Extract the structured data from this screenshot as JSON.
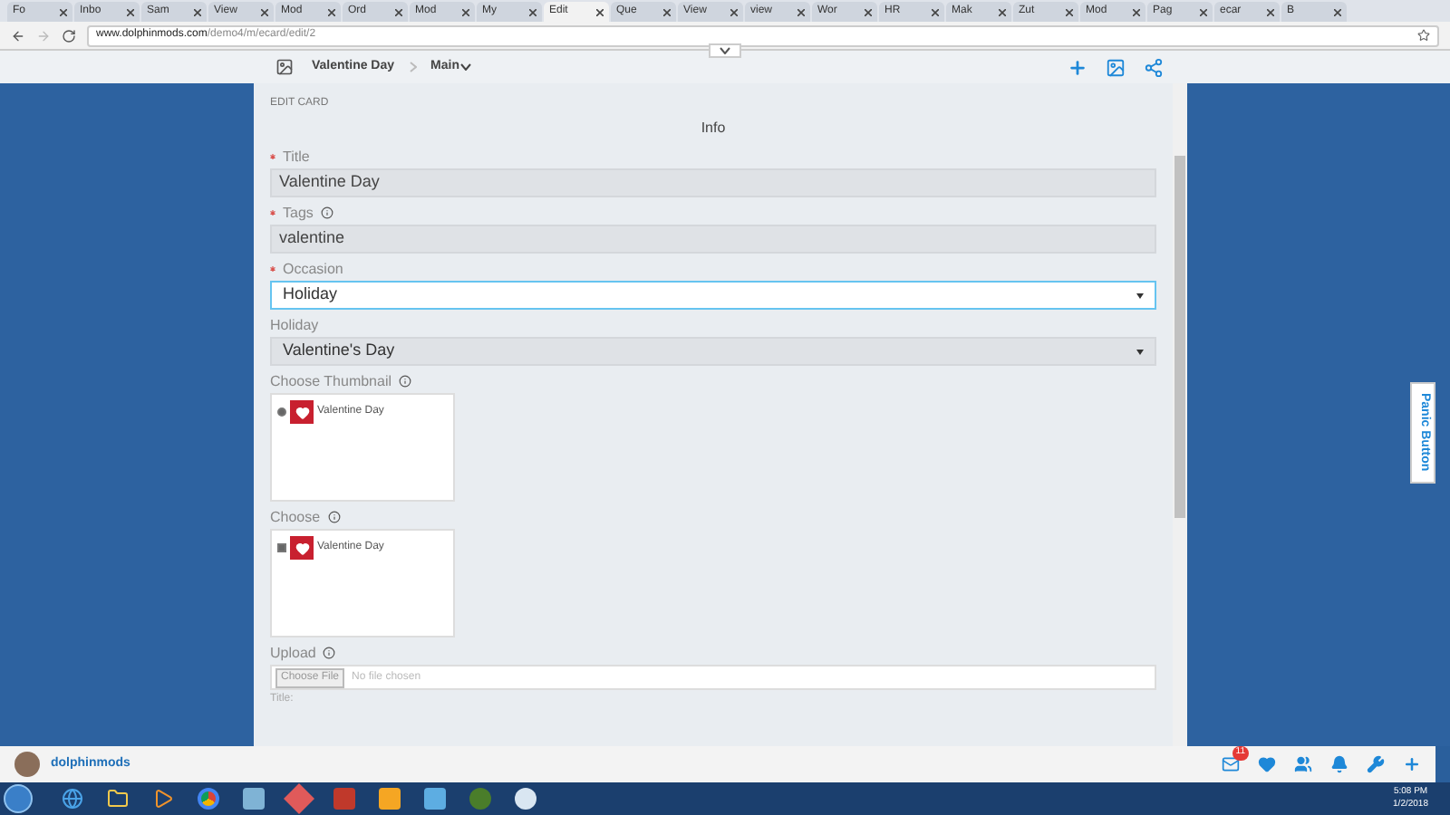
{
  "browser": {
    "tabs": [
      {
        "label": "Fo",
        "selected": false
      },
      {
        "label": "Inbo",
        "selected": false
      },
      {
        "label": "Sam",
        "selected": false
      },
      {
        "label": "View",
        "selected": false
      },
      {
        "label": "Mod",
        "selected": false
      },
      {
        "label": "Ord",
        "selected": false
      },
      {
        "label": "Mod",
        "selected": false
      },
      {
        "label": "My",
        "selected": false
      },
      {
        "label": "Edit",
        "selected": true
      },
      {
        "label": "Que",
        "selected": false
      },
      {
        "label": "View",
        "selected": false
      },
      {
        "label": "view",
        "selected": false
      },
      {
        "label": "Wor",
        "selected": false
      },
      {
        "label": "HR",
        "selected": false
      },
      {
        "label": "Mak",
        "selected": false
      },
      {
        "label": "Zut",
        "selected": false
      },
      {
        "label": "Mod",
        "selected": false
      },
      {
        "label": "Pag",
        "selected": false
      },
      {
        "label": "ecar",
        "selected": false
      },
      {
        "label": "B",
        "selected": false
      }
    ],
    "url_host": "www.dolphinmods.com",
    "url_path": "/demo4/m/ecard/edit/2"
  },
  "header": {
    "title": "Valentine Day",
    "section": "Main"
  },
  "card": {
    "heading": "EDIT CARD",
    "section_title": "Info",
    "fields": [
      {
        "kind": "text",
        "label": "Title",
        "required": true,
        "info": false,
        "value": "Valentine Day",
        "focused": false
      },
      {
        "kind": "text",
        "label": "Tags",
        "required": true,
        "info": true,
        "value": "valentine",
        "focused": false
      },
      {
        "kind": "select",
        "label": "Occasion",
        "required": true,
        "info": false,
        "value": "Holiday",
        "focused": true
      },
      {
        "kind": "select",
        "label": "Holiday",
        "required": false,
        "info": false,
        "value": "Valentine's Day",
        "focused": false
      },
      {
        "kind": "radio",
        "label": "Choose Thumbnail",
        "required": false,
        "info": true,
        "options": [
          {
            "label": "Valentine Day",
            "checked": true
          }
        ]
      },
      {
        "kind": "checkbox",
        "label": "Choose",
        "required": false,
        "info": true,
        "options": [
          {
            "label": "Valentine Day",
            "checked": true
          }
        ]
      },
      {
        "kind": "file",
        "label": "Upload",
        "required": false,
        "info": true,
        "button": "Choose File",
        "status": "No file chosen"
      }
    ],
    "next_label": "Title:"
  },
  "panic_button": "Panic Button",
  "bottom_bar": {
    "username": "dolphinmods",
    "message_count": "11"
  },
  "taskbar": {
    "time": "5:08 PM",
    "date": "1/2/2018"
  }
}
